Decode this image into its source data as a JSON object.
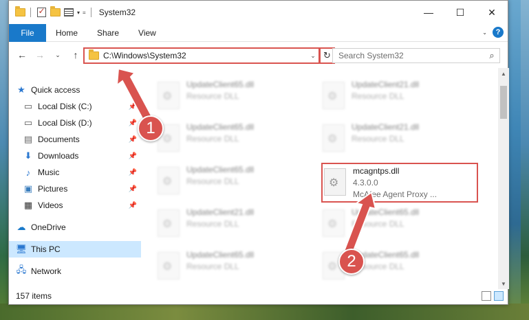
{
  "window": {
    "title": "System32",
    "controls": {
      "minimize": "—",
      "maximize": "☐",
      "close": "✕"
    }
  },
  "ribbon": {
    "tabs": [
      "File",
      "Home",
      "Share",
      "View"
    ],
    "help": "?"
  },
  "address": {
    "path": "C:\\Windows\\System32",
    "search_placeholder": "Search System32"
  },
  "nav": {
    "quick_access": "Quick access",
    "items": [
      {
        "label": "Local Disk (C:)",
        "icon": "drive-icon",
        "pinned": true
      },
      {
        "label": "Local Disk (D:)",
        "icon": "drive-icon",
        "pinned": true
      },
      {
        "label": "Documents",
        "icon": "documents-icon",
        "pinned": true
      },
      {
        "label": "Downloads",
        "icon": "download-icon",
        "pinned": true
      },
      {
        "label": "Music",
        "icon": "music-icon",
        "pinned": true
      },
      {
        "label": "Pictures",
        "icon": "pictures-icon",
        "pinned": true
      },
      {
        "label": "Videos",
        "icon": "videos-icon",
        "pinned": true
      }
    ],
    "onedrive": "OneDrive",
    "this_pc": "This PC",
    "network": "Network"
  },
  "files": [
    {
      "name": "UpdateClient65.dll",
      "type": "Resource DLL"
    },
    {
      "name": "UpdateClient21.dll",
      "type": "Resource DLL"
    },
    {
      "name": "UpdateClient65.dll",
      "type": "Resource DLL"
    },
    {
      "name": "UpdateClient21.dll",
      "type": "Resource DLL"
    },
    {
      "name": "UpdateClient65.dll",
      "type": "Resource DLL"
    },
    {
      "name": "UpdateClient21.dll",
      "type": "Resource DLL"
    },
    {
      "name": "UpdateClient65.dll",
      "type": "Resource DLL"
    },
    {
      "name": "UpdateClient65.dll",
      "type": "Resource DLL"
    },
    {
      "name": "UpdateClient65.dll",
      "type": "Resource DLL"
    }
  ],
  "highlighted_file": {
    "name": "mcagntps.dll",
    "version": "4.3.0.0",
    "description": "McAfee Agent Proxy ..."
  },
  "status": {
    "item_count": "157 items"
  },
  "annotations": {
    "step1": "1",
    "step2": "2"
  },
  "colors": {
    "accent": "#1979ca",
    "annotation": "#d9534f",
    "selected": "#cce8ff"
  }
}
